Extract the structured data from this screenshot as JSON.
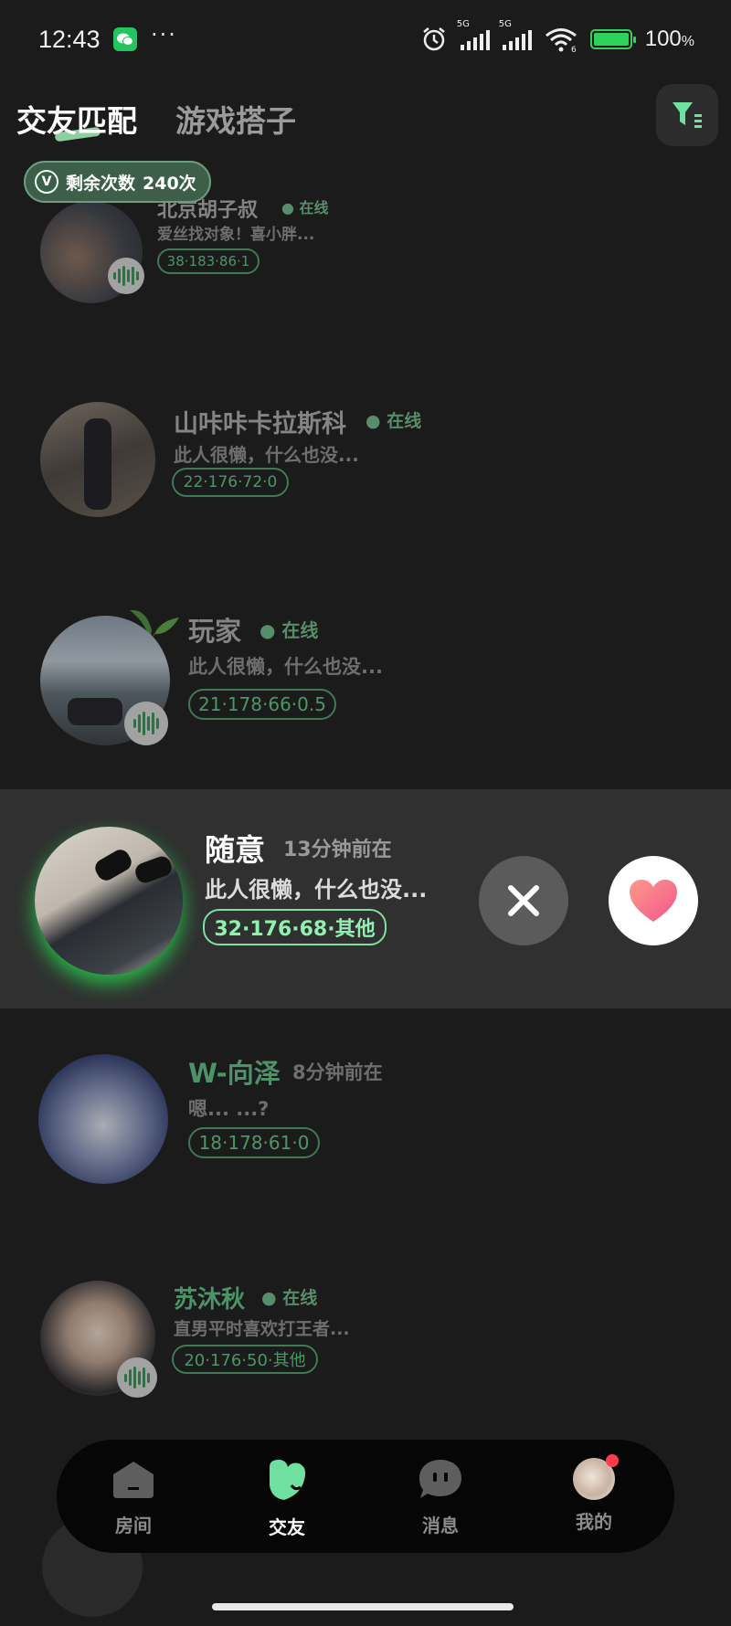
{
  "status_bar": {
    "time": "12:43",
    "network_1": "5G",
    "network_2": "5G",
    "wifi_sub": "6",
    "battery": "100",
    "battery_unit": "%",
    "battery_level": 1.0,
    "icons": [
      "wechat-icon",
      "alarm-icon",
      "signal-icon",
      "wifi-icon",
      "battery-icon"
    ]
  },
  "header": {
    "tab_active": "交友匹配",
    "tab_inactive": "游戏搭子",
    "remaining_label": "剩余次数",
    "remaining_count": "240次",
    "filter_icon": "filter-icon"
  },
  "users": [
    {
      "name": "北京胡子叔",
      "status": "● 在线",
      "bio": "爱丝找对象！喜小胖...",
      "tag": "38·183·86·1",
      "voice": true
    },
    {
      "name": "山咔咔卡拉斯科",
      "status": "● 在线",
      "bio": "此人很懒，什么也没...",
      "tag": "22·176·72·0",
      "voice": false
    },
    {
      "name": "玩家",
      "status": "● 在线",
      "bio": "此人很懒，什么也没...",
      "tag": "21·178·66·0.5",
      "voice": true
    },
    {
      "name": "W-向泽",
      "status": "8分钟前在",
      "bio": "嗯... ...?",
      "tag": "18·178·61·0",
      "voice": false
    },
    {
      "name": "苏沐秋",
      "status": "● 在线",
      "bio": "直男平时喜欢打王者...",
      "tag": "20·176·50·其他",
      "voice": true
    }
  ],
  "featured": {
    "name": "随意",
    "status": "13分钟前在",
    "bio": "此人很懒，什么也没...",
    "tag": "32·176·68·其他"
  },
  "nav": {
    "items": [
      {
        "label": "房间",
        "icon": "house-icon"
      },
      {
        "label": "交友",
        "icon": "heart-icon"
      },
      {
        "label": "消息",
        "icon": "message-icon"
      },
      {
        "label": "我的",
        "icon": "avatar-icon"
      }
    ]
  },
  "colors": {
    "accent": "#5cbf80",
    "background": "#1b1b1b",
    "card": "#303030",
    "heart": "#ff6f8a"
  }
}
